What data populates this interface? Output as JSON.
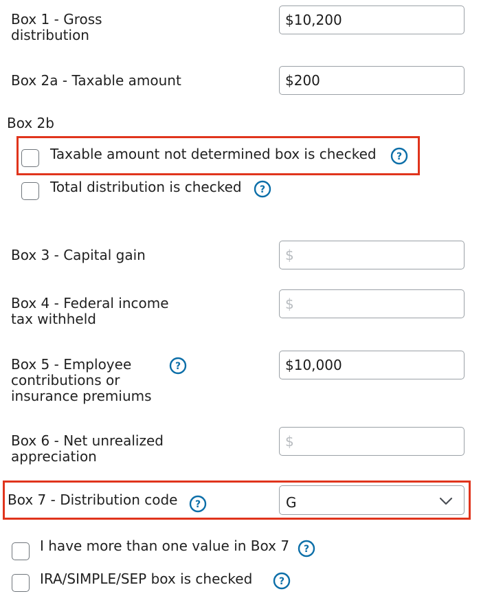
{
  "box1": {
    "label_line1": "Box 1 - Gross",
    "label_line2": "distribution",
    "value": "$10,200"
  },
  "box2a": {
    "label": "Box 2a - Taxable amount",
    "value": "$200"
  },
  "box2b": {
    "heading": "Box 2b",
    "not_determined": {
      "label": "Taxable amount not determined box is checked",
      "checked": false
    },
    "total_distribution": {
      "label": "Total distribution is checked",
      "checked": false
    }
  },
  "box3": {
    "label": "Box 3 - Capital gain",
    "placeholder": "$",
    "value": ""
  },
  "box4": {
    "label_line1": "Box 4 - Federal income",
    "label_line2": "tax withheld",
    "placeholder": "$",
    "value": ""
  },
  "box5": {
    "label_line1": "Box 5 - Employee",
    "label_line2": "contributions or",
    "label_line3": "insurance premiums",
    "value": "$10,000"
  },
  "box6": {
    "label_line1": "Box 6 - Net unrealized",
    "label_line2": "appreciation",
    "placeholder": "$",
    "value": ""
  },
  "box7": {
    "label": "Box 7 - Distribution code",
    "selected": "G",
    "more_than_one": {
      "label": "I have more than one value in Box 7",
      "checked": false
    },
    "ira_simple_sep": {
      "label": "IRA/SIMPLE/SEP box is checked",
      "checked": false
    }
  },
  "colors": {
    "accent": "#0b6ea8",
    "highlight": "#e0341c",
    "border": "#9aa0a6"
  },
  "icons": {
    "help": "question-circle-icon",
    "dropdown": "chevron-down-icon"
  }
}
